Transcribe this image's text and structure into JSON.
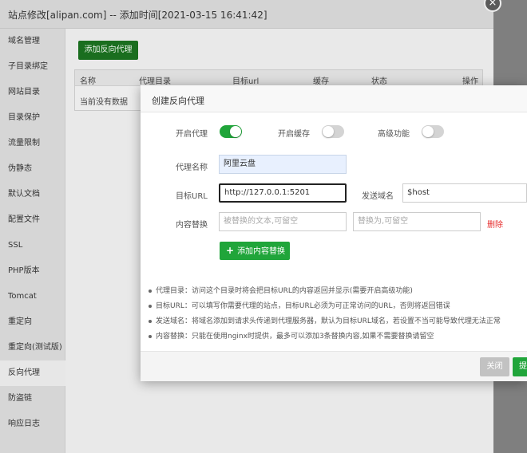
{
  "outer": {
    "title": "站点修改[alipan.com] -- 添加时间[2021-03-15 16:41:42]",
    "close_icon": "×",
    "sidebar": [
      "域名管理",
      "子目录绑定",
      "网站目录",
      "目录保护",
      "流量限制",
      "伪静态",
      "默认文档",
      "配置文件",
      "SSL",
      "PHP版本",
      "Tomcat",
      "重定向",
      "重定向(测试版)",
      "反向代理",
      "防盗链",
      "响应日志"
    ],
    "sidebar_active": "反向代理",
    "add_proxy_label": "添加反向代理",
    "table": {
      "headers": [
        "名称",
        "代理目录",
        "目标url",
        "缓存",
        "状态",
        "操作"
      ],
      "empty_text": "当前没有数据"
    }
  },
  "modal": {
    "title": "创建反向代理",
    "toggles": [
      {
        "label": "开启代理",
        "on": true
      },
      {
        "label": "开启缓存",
        "on": false
      },
      {
        "label": "高级功能",
        "on": false
      }
    ],
    "proxy_name": {
      "label": "代理名称",
      "value": "阿里云盘"
    },
    "target_url": {
      "label": "目标URL",
      "value": "http://127.0.0.1:5201"
    },
    "send_domain": {
      "label": "发送域名",
      "value": "$host"
    },
    "content_replace": {
      "label": "内容替换",
      "placeholder_from": "被替换的文本,可留空",
      "placeholder_to": "替换为,可留空",
      "delete_label": "删除"
    },
    "add_content_label": "添加内容替换",
    "notes": [
      "代理目录：访问这个目录时将会把目标URL的内容返回并显示(需要开启高级功能)",
      "目标URL：可以填写你需要代理的站点，目标URL必须为可正常访问的URL，否则将返回错误",
      "发送域名：将域名添加到请求头传递到代理服务器，默认为目标URL域名，若设置不当可能导致代理无法正常",
      "内容替换：只能在使用nginx时提供，最多可以添加3条替换内容,如果不需要替换请留空"
    ],
    "footer": {
      "close_label": "关闭",
      "submit_label": "提交"
    }
  },
  "colors": {
    "accent": "#20a53a",
    "danger": "#e62c2c",
    "focus_border": "#222222"
  }
}
